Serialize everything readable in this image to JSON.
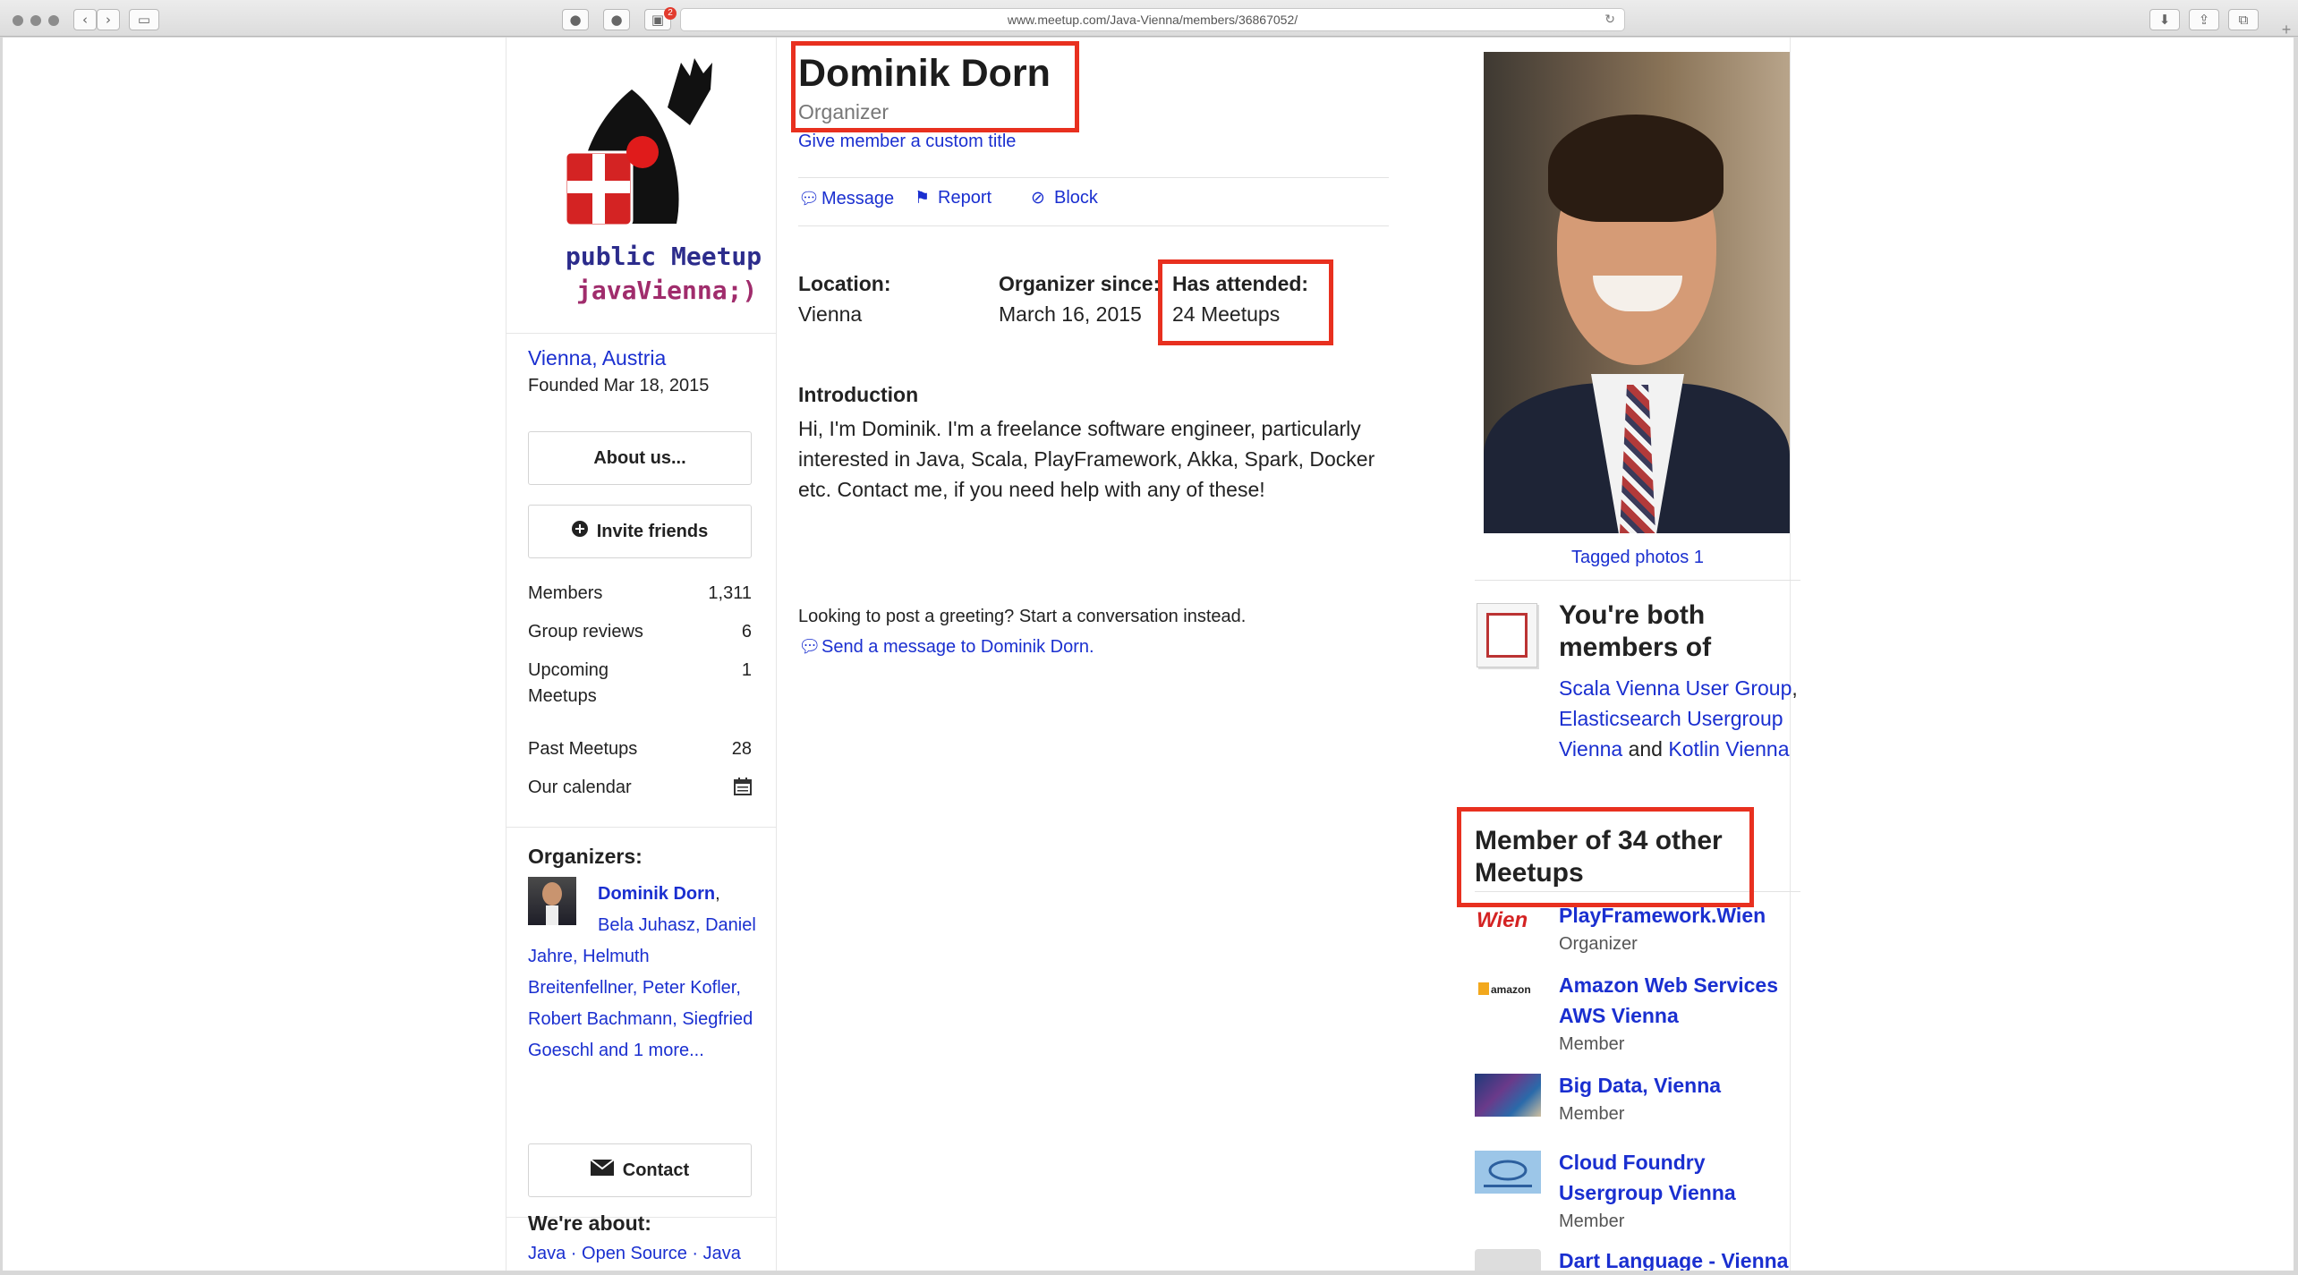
{
  "browser": {
    "url": "www.meetup.com/Java-Vienna/members/36867052/",
    "blocker_badge": "2"
  },
  "group": {
    "logo_text_line1": "public Meetup",
    "logo_text_line2": "javaVienna;)",
    "location": "Vienna, Austria",
    "founded": "Founded Mar 18, 2015",
    "about_button": "About us...",
    "invite_button": "Invite friends",
    "stats": [
      {
        "label": "Members",
        "value": "1,311"
      },
      {
        "label": "Group reviews",
        "value": "6"
      },
      {
        "label": "Upcoming",
        "label2": "Meetups",
        "value": "1"
      },
      {
        "label": "Past Meetups",
        "value": "28"
      },
      {
        "label": "Our calendar"
      }
    ],
    "organizers_title": "Organizers:",
    "organizers": {
      "first": "Dominik Dorn",
      "rest": "Bela Juhasz, Daniel Jahre, Helmuth Breitenfellner, Peter Kofler, Robert Bachmann, Siegfried Goeschl",
      "more": "and 1 more..."
    },
    "contact_button": "Contact",
    "about_title": "We're about:",
    "about_tags": "Java · Open Source · Java"
  },
  "member": {
    "name": "Dominik Dorn",
    "role": "Organizer",
    "custom_title_link": "Give member a custom title",
    "actions": {
      "message": "Message",
      "report": "Report",
      "block": "Block"
    },
    "location_label": "Location:",
    "location_value": "Vienna",
    "organizer_since_label": "Organizer since:",
    "organizer_since_value": "March 16, 2015",
    "attended_label": "Has attended:",
    "attended_value": "24 Meetups",
    "intro_title": "Introduction",
    "intro_text": "Hi, I'm Dominik. I'm a freelance software engineer, particularly interested in Java, Scala, PlayFramework, Akka, Spark, Docker etc. Contact me, if you need help with any of these!",
    "greeting_text": "Looking to post a greeting? Start a conversation instead.",
    "send_message_link": "Send a message to Dominik Dorn."
  },
  "sidebar_right": {
    "tagged_photos": "Tagged photos 1",
    "both_members_title": "You're both members of",
    "both_groups": [
      "Scala Vienna User Group",
      "Elasticsearch Usergroup Vienna",
      "Kotlin Vienna"
    ],
    "both_and": "and",
    "other_meetups_title": "Member of 34 other Meetups",
    "other_groups": [
      {
        "name": "PlayFramework.Wien",
        "role": "Organizer",
        "logo": "Wien"
      },
      {
        "name": "Amazon Web Services AWS Vienna",
        "role": "Member",
        "logo": "amazon"
      },
      {
        "name": "Big Data, Vienna",
        "role": "Member"
      },
      {
        "name": "Cloud Foundry Usergroup Vienna",
        "role": "Member"
      },
      {
        "name": "Dart Language - Vienna"
      }
    ]
  },
  "colors": {
    "link": "#1a2fd0",
    "highlight_box": "#e8301f"
  }
}
